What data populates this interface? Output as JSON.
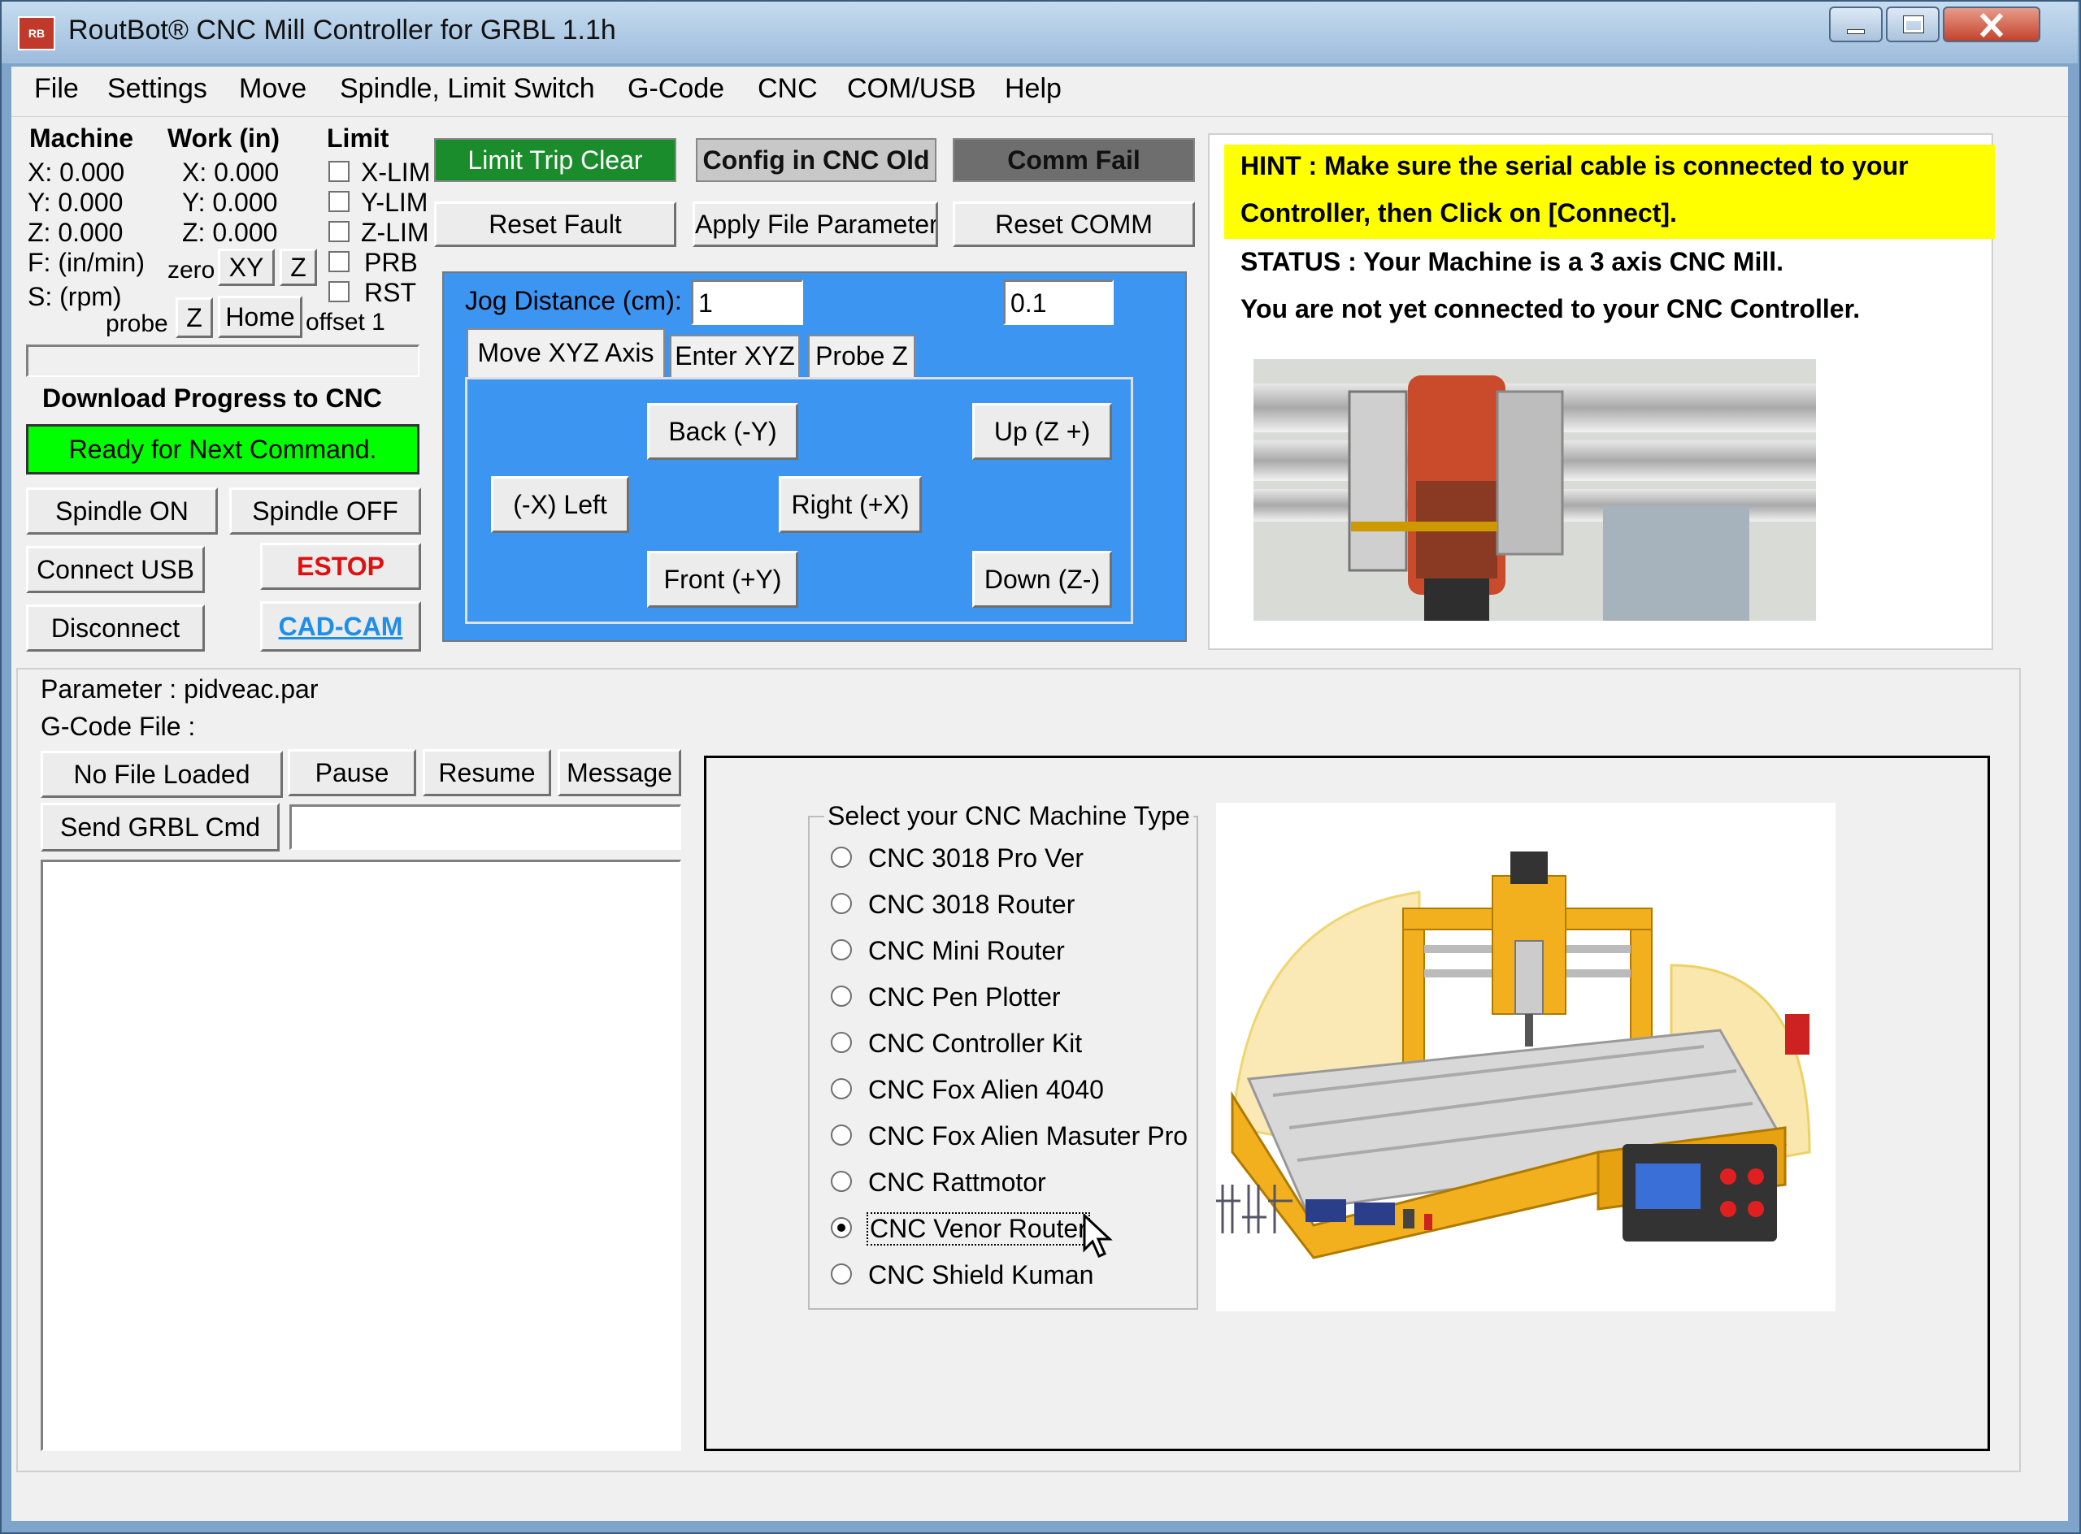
{
  "window": {
    "title": "RoutBot® CNC Mill Controller for GRBL 1.1h",
    "icon_text": "RB",
    "controls": [
      "minimize-icon",
      "maximize-icon",
      "close-icon"
    ]
  },
  "menu": [
    "File",
    "Settings",
    "Move",
    "Spindle, Limit Switch",
    "G-Code",
    "CNC",
    "COM/USB",
    "Help"
  ],
  "position": {
    "machine_header": "Machine",
    "work_header": "Work (in)",
    "limit_header": "Limit",
    "machine": [
      "X: 0.000",
      "Y: 0.000",
      "Z: 0.000",
      "F: (in/min)",
      "S: (rpm)"
    ],
    "work": [
      "X: 0.000",
      "Y: 0.000",
      "Z: 0.000"
    ],
    "limits": [
      "X-LIM",
      "Y-LIM",
      "Z-LIM",
      "PRB",
      "RST"
    ],
    "zero_label": "zero",
    "zero_xy": "XY",
    "zero_z": "Z",
    "probe_label": "probe",
    "probe_z": "Z",
    "home": "Home",
    "offset": "offset 1"
  },
  "status_indicators": {
    "limit_trip": "Limit Trip Clear",
    "config": "Config in CNC Old",
    "comm": "Comm Fail",
    "limit_color": "#1a8c2c",
    "comm_color": "#6e6e6e"
  },
  "actions": {
    "reset_fault": "Reset Fault",
    "apply_params": "Apply File Parameters",
    "reset_comm": "Reset COMM"
  },
  "download": {
    "title": "Download Progress to CNC",
    "status": "Ready for Next Command.",
    "status_color": "#00ff00"
  },
  "controls": {
    "spindle_on": "Spindle ON",
    "spindle_off": "Spindle OFF",
    "connect_usb": "Connect USB",
    "estop": "ESTOP",
    "disconnect": "Disconnect",
    "cadcam": "CAD-CAM"
  },
  "jog": {
    "distance_label": "Jog Distance (cm):",
    "distance_value": "1",
    "distance_value2": "0.1",
    "tabs": [
      "Move XYZ Axis",
      "Enter XYZ",
      "Probe Z"
    ],
    "back": "Back  (-Y)",
    "up": "Up (Z +)",
    "left": "(-X) Left",
    "right": "Right  (+X)",
    "front": "Front  (+Y)",
    "down": "Down (Z-)",
    "bg_color": "#3d95f2"
  },
  "hint": {
    "line1": "HINT    : Make sure the serial cable is connected to your",
    "line2": "Controller, then Click on [Connect].",
    "status1": "STATUS : Your Machine is a 3 axis CNC Mill.",
    "status2": "You are not yet connected to your CNC Controller.",
    "highlight_color": "#ffff00"
  },
  "file": {
    "parameter": "Parameter : pidveac.par",
    "gcode": "G-Code File :",
    "no_file": "No File Loaded",
    "pause": "Pause",
    "resume": "Resume",
    "message": "Message",
    "send_cmd": "Send GRBL Cmd",
    "cmd_value": ""
  },
  "machine_type": {
    "legend": "Select your CNC Machine Type",
    "options": [
      "CNC 3018 Pro Ver",
      "CNC 3018 Router",
      "CNC Mini Router",
      "CNC Pen Plotter",
      "CNC Controller Kit",
      "CNC Fox Alien 4040",
      "CNC Fox Alien Masuter Pro",
      "CNC Rattmotor",
      "CNC Venor Router",
      "CNC Shield Kuman"
    ],
    "selected": "CNC Venor Router"
  }
}
